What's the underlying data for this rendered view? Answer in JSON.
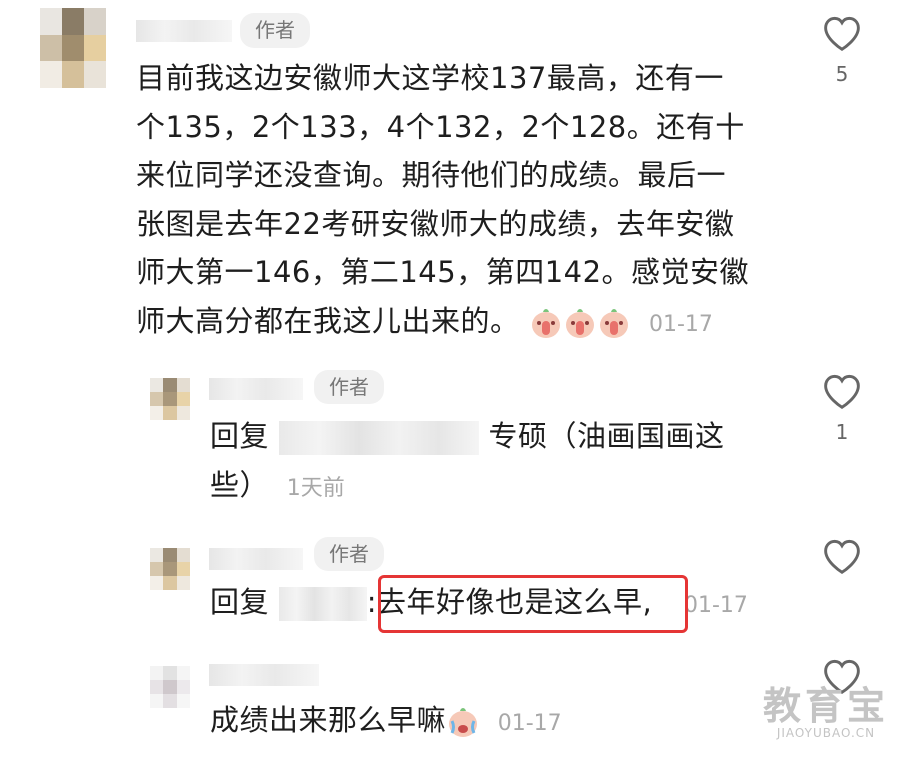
{
  "author_badge": "作者",
  "comments": [
    {
      "body_lines": [
        "目前我这边安徽师大这学校137最高，还有一",
        "个135，2个133，4个132，2个128。还有十",
        "来位同学还没查询。期待他们的成绩。最后一",
        "张图是去年22考研安徽师大的成绩，去年安徽",
        "师大第一146，第二145，第四142。感觉安徽",
        "师大高分都在我这儿出来的。"
      ],
      "time": "01-17",
      "likes": "5"
    },
    {
      "reply_prefix": "回复",
      "reply_text": "专硕（油画国画这",
      "reply_text_line2": "些）",
      "time": "1天前",
      "likes": "1"
    },
    {
      "reply_prefix": "回复",
      "reply_colon": ":",
      "reply_text": "去年好像也是这么早,",
      "time": "01-17"
    },
    {
      "body": "成绩出来那么早嘛",
      "time": "01-17"
    }
  ],
  "watermark": {
    "title": "教育宝",
    "url": "JIAOYUBAO.CN"
  },
  "colors": {
    "highlight_border": "#e53535",
    "time_text": "#a8a8a8"
  }
}
